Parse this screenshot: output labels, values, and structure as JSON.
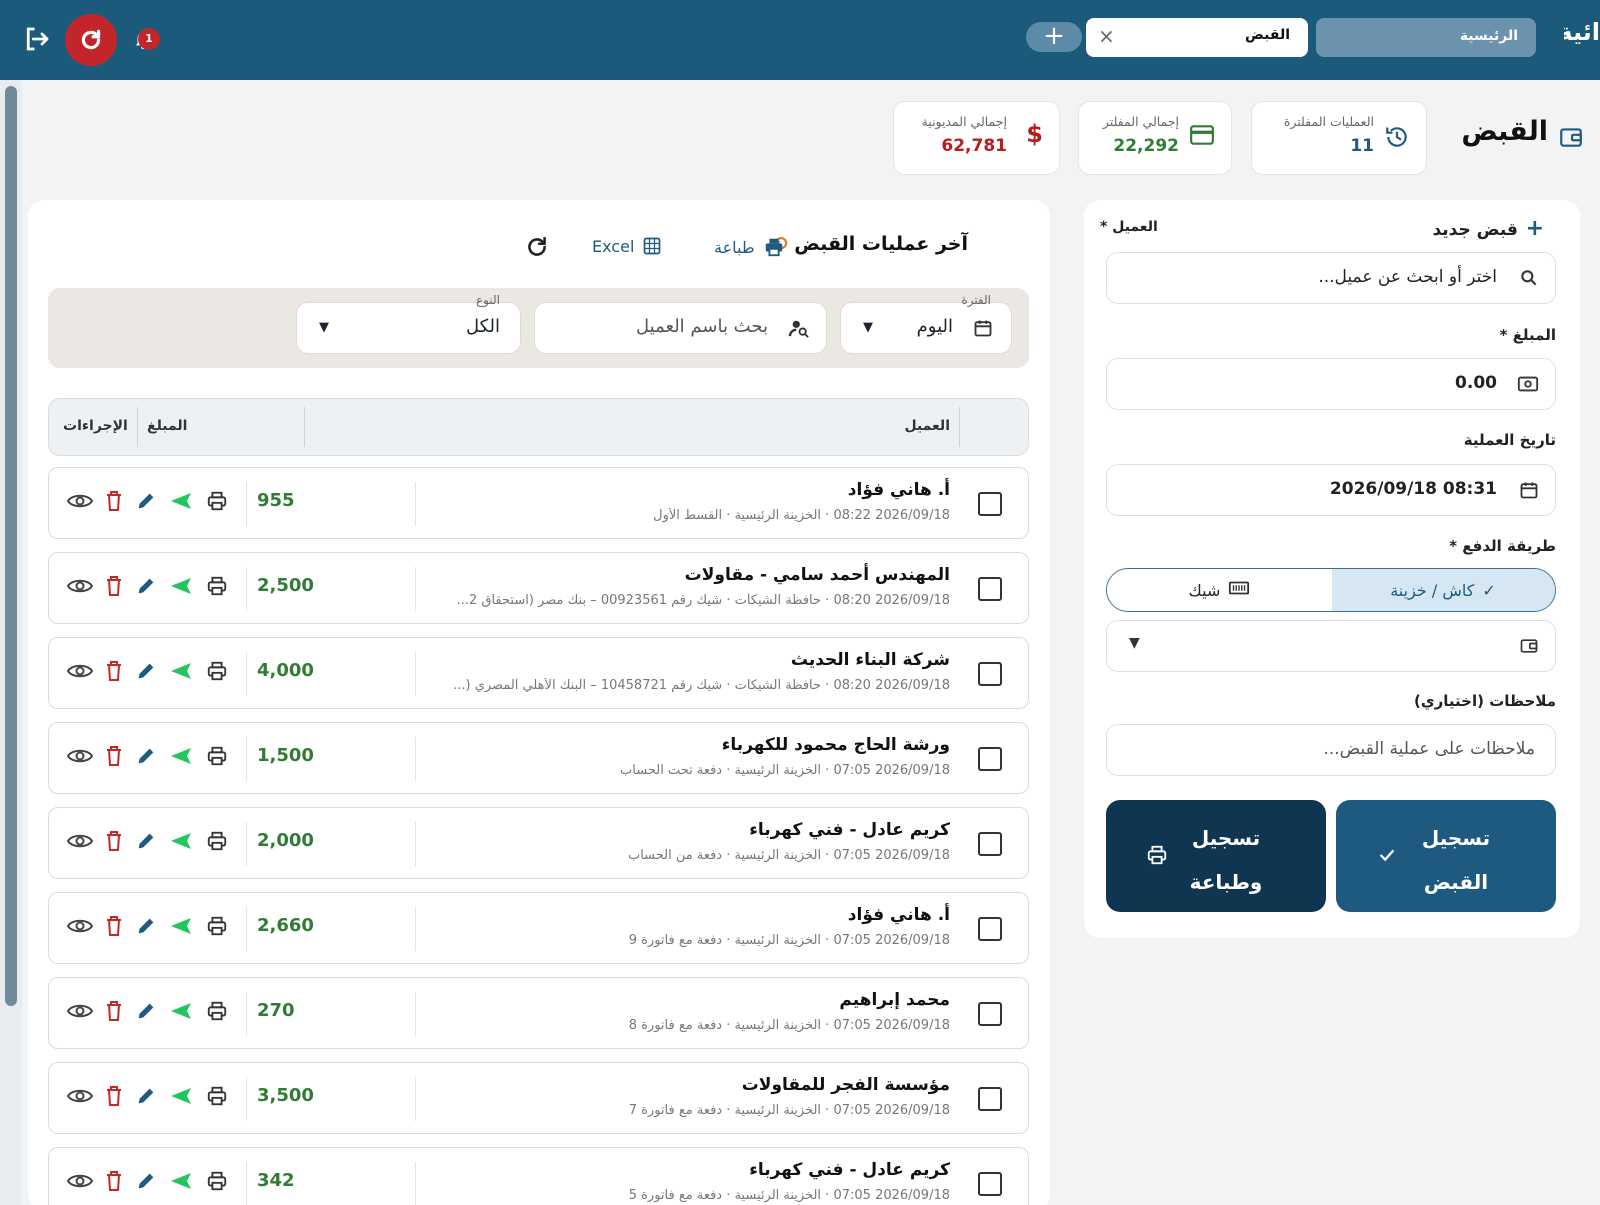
{
  "topbar": {
    "brand_fragment": "ائية",
    "tabs": [
      {
        "label": "الرئيسية"
      },
      {
        "label": "القبض"
      }
    ],
    "notifications_count": "1"
  },
  "page": {
    "title": "القبض",
    "stats": [
      {
        "label": "العمليات المفلترة",
        "value": "11",
        "color": "#1e5a82",
        "icon": "history-icon"
      },
      {
        "label": "إجمالي المفلتر",
        "value": "22,292",
        "color": "#2e7d32",
        "icon": "credit-card-icon"
      },
      {
        "label": "إجمالي المديونية",
        "value": "62,781",
        "color": "#b71c1c",
        "icon": "dollar-icon"
      }
    ]
  },
  "form": {
    "title": "قبض جديد",
    "client_label": "العميل *",
    "client_placeholder": "اختر أو ابحث عن عميل...",
    "amount_label": "المبلغ *",
    "amount_value": "0.00",
    "date_label": "تاريخ العملية",
    "date_value": "2026/09/18 08:31",
    "payment_label": "طريقة الدفع *",
    "payment_cash": "كاش / خزينة",
    "payment_check": "شيك",
    "notes_label": "ملاحظات (اختياري)",
    "notes_placeholder": "ملاحظات على عملية القبض...",
    "submit_label": "تسجيل القبض",
    "submit_print_label": "تسجيل وطباعة",
    "submit_color": "#1e5a7f",
    "submit_print_color": "#0f3550"
  },
  "list": {
    "title": "آخر عمليات القبض",
    "print_label": "طباعة",
    "excel_label": "Excel",
    "filters": {
      "period_caption": "الفترة",
      "period_value": "اليوم",
      "search_placeholder": "بحث باسم العميل",
      "type_caption": "النوع",
      "type_value": "الكل"
    },
    "columns": {
      "client": "العميل",
      "amount": "المبلغ",
      "actions": "الإجراءات"
    },
    "rows": [
      {
        "name": "أ. هاني فؤاد",
        "meta": "2026/09/18 08:22 · الخزينة الرئيسية · القسط الأول",
        "amount": "955"
      },
      {
        "name": "المهندس أحمد سامي - مقاولات",
        "meta": "2026/09/18 08:20 · حافظة الشيكات · شيك رقم 00923561 – بنك مصر (استحقاق 2...",
        "amount": "2,500"
      },
      {
        "name": "شركة البناء الحديث",
        "meta": "2026/09/18 08:20 · حافظة الشيكات · شيك رقم 10458721 – البنك الأهلي المصري (...",
        "amount": "4,000"
      },
      {
        "name": "ورشة الحاج محمود للكهرباء",
        "meta": "2026/09/18 07:05 · الخزينة الرئيسية · دفعة تحت الحساب",
        "amount": "1,500"
      },
      {
        "name": "كريم عادل - فني كهرباء",
        "meta": "2026/09/18 07:05 · الخزينة الرئيسية · دفعة من الحساب",
        "amount": "2,000"
      },
      {
        "name": "أ. هاني فؤاد",
        "meta": "2026/09/18 07:05 · الخزينة الرئيسية · دفعة مع فاتورة 9",
        "amount": "2,660"
      },
      {
        "name": "محمد إبراهيم",
        "meta": "2026/09/18 07:05 · الخزينة الرئيسية · دفعة مع فاتورة 8",
        "amount": "270"
      },
      {
        "name": "مؤسسة الفجر للمقاولات",
        "meta": "2026/09/18 07:05 · الخزينة الرئيسية · دفعة مع فاتورة 7",
        "amount": "3,500"
      },
      {
        "name": "كريم عادل - فني كهرباء",
        "meta": "2026/09/18 07:05 · الخزينة الرئيسية · دفعة مع فاتورة 5",
        "amount": "342"
      }
    ]
  }
}
